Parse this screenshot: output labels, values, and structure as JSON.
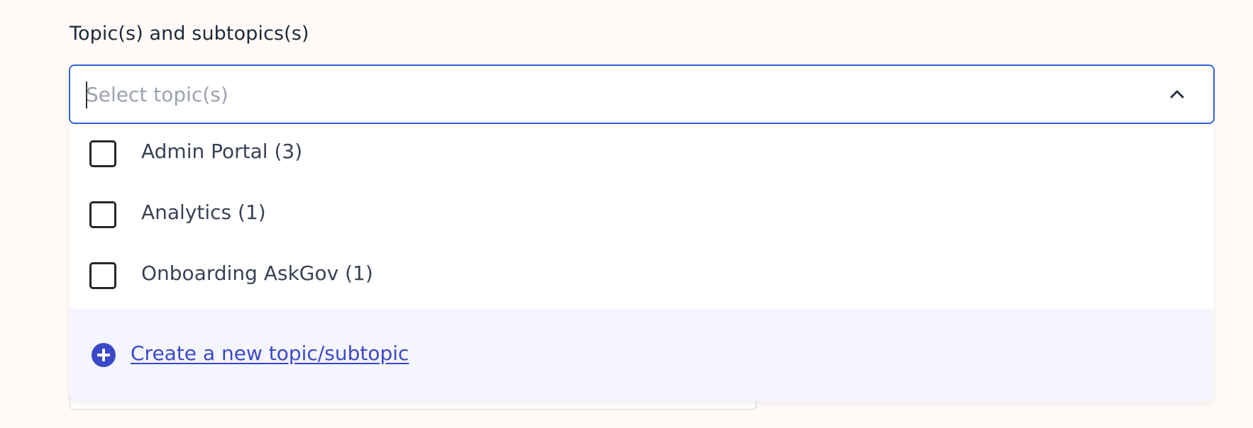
{
  "field": {
    "label": "Topic(s) and subtopics(s)",
    "placeholder": "Select topic(s)",
    "value": ""
  },
  "dropdown": {
    "options": [
      {
        "label": "Admin Portal (3)",
        "checked": false
      },
      {
        "label": "Analytics (1)",
        "checked": false
      },
      {
        "label": "Onboarding AskGov (1)",
        "checked": false
      }
    ],
    "create_link": "Create a new topic/subtopic"
  },
  "icons": {
    "toggle": "chevron-up-icon",
    "create": "plus-circle-icon"
  },
  "colors": {
    "focus_border": "#2f64d8",
    "link": "#3b49c9",
    "footer_bg": "#f4f5fd",
    "page_bg": "#fffaf7"
  }
}
